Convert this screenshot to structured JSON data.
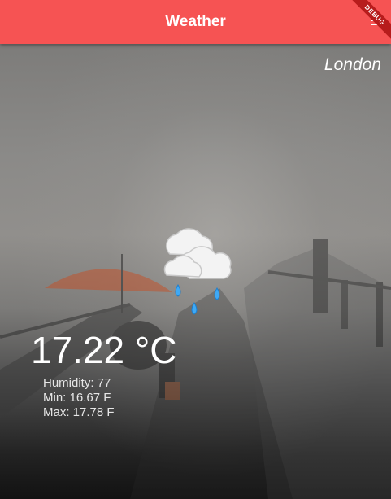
{
  "app_bar": {
    "title": "Weather",
    "menu_icon": "menu-icon",
    "debug_banner": "DEBUG"
  },
  "weather": {
    "city": "London",
    "icon": "cloud-rain-icon",
    "temperature": "17.22 °C",
    "humidity": "Humidity: 77",
    "min": "Min: 16.67 F",
    "max": "Max: 17.78 F"
  },
  "colors": {
    "app_bar": "#f65353",
    "debug_ribbon": "#b71c1c",
    "text": "#ffffff"
  }
}
